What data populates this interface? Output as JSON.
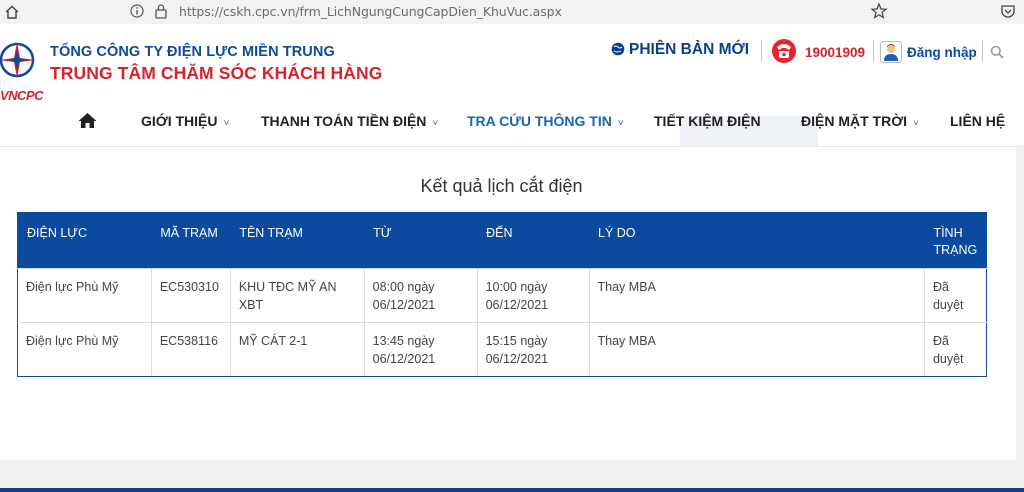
{
  "browser": {
    "url": "https://cskh.cpc.vn/frm_LichNgungCungCapDien_KhuVuc.aspx"
  },
  "header": {
    "logo_text": "VNCPC",
    "org_line1": "TỔNG CÔNG TY ĐIỆN LỰC MIỀN TRUNG",
    "org_line2": "TRUNG TÂM CHĂM SÓC KHÁCH HÀNG",
    "new_version": "PHIÊN BẢN MỚI",
    "hotline": "19001909",
    "login": "Đăng nhập"
  },
  "nav": {
    "items": [
      {
        "label": "GIỚI THIỆU",
        "chevron": "˅"
      },
      {
        "label": "THANH TOÁN TIỀN ĐIỆN",
        "chevron": "˅"
      },
      {
        "label": "TRA CỨU THÔNG TIN",
        "chevron": "˅"
      },
      {
        "label": "TIẾT KIỆM ĐIỆN"
      },
      {
        "label": "ĐIỆN MẶT TRỜI",
        "chevron": "˅"
      },
      {
        "label": "LIÊN HỆ"
      }
    ]
  },
  "main": {
    "title": "Kết quả lịch cắt điện",
    "table": {
      "headers": [
        "ĐIỆN LỰC",
        "MÃ TRẠM",
        "TÊN TRẠM",
        "TỪ",
        "ĐẾN",
        "LÝ DO",
        "TÌNH TRẠNG"
      ],
      "rows": [
        [
          "Điện lực Phù Mỹ",
          "EC530310",
          "KHU TĐC MỸ AN XBT",
          "08:00 ngày 06/12/2021",
          "10:00 ngày 06/12/2021",
          "Thay MBA",
          "Đã duyệt"
        ],
        [
          "Điện lực Phù Mỹ",
          "EC538116",
          "MỸ CÁT 2-1",
          "13:45 ngày 06/12/2021",
          "15:15 ngày 06/12/2021",
          "Thay MBA",
          "Đã duyệt"
        ]
      ]
    }
  },
  "colors": {
    "brand_blue": "#0b4a9e",
    "brand_red": "#d7232c",
    "active_nav": "#1766b3"
  }
}
